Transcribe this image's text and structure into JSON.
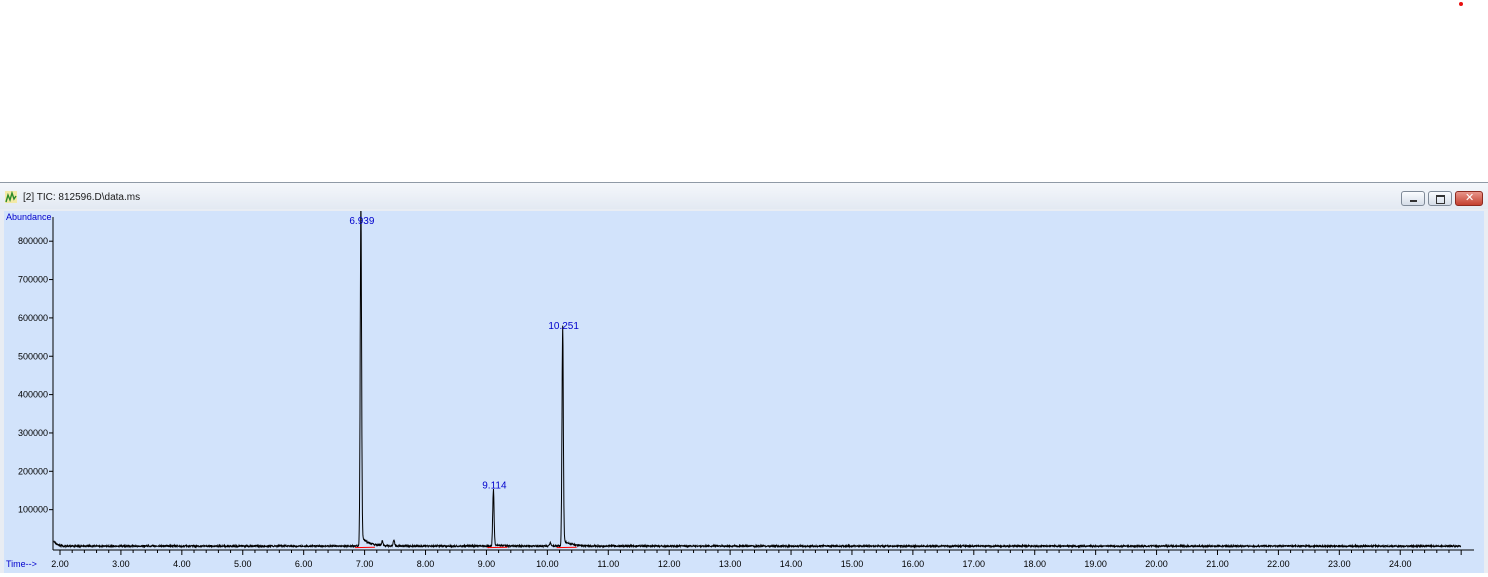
{
  "window": {
    "title": "[2] TIC: 812596.D\\data.ms",
    "controls": [
      "minimize",
      "maximize",
      "close"
    ],
    "app_icon": "chromatogram-app-icon"
  },
  "colors": {
    "plot_background": "#d2e3fb",
    "trace": "#000000",
    "labels": "#0000cc",
    "baseline": "#ff0000"
  },
  "chart_data": {
    "type": "line",
    "ylabel": "Abundance",
    "xlabel": "Time-->",
    "xlim": [
      1.9,
      25.1
    ],
    "ylim": [
      0,
      880000
    ],
    "x_ticks": [
      "2.00",
      "3.00",
      "4.00",
      "5.00",
      "6.00",
      "7.00",
      "8.00",
      "9.00",
      "10.00",
      "11.00",
      "12.00",
      "13.00",
      "14.00",
      "15.00",
      "16.00",
      "17.00",
      "18.00",
      "19.00",
      "20.00",
      "21.00",
      "22.00",
      "23.00",
      "24.00"
    ],
    "y_ticks": [
      "100000",
      "200000",
      "300000",
      "400000",
      "500000",
      "600000",
      "700000",
      "800000"
    ],
    "peaks": [
      {
        "label": "6.939",
        "rt": 6.939,
        "height": 880000
      },
      {
        "label": "9.114",
        "rt": 9.114,
        "height": 145000
      },
      {
        "label": "10.251",
        "rt": 10.251,
        "height": 560000
      }
    ],
    "minor_peaks": [
      {
        "rt": 7.29,
        "height": 12000
      },
      {
        "rt": 7.48,
        "height": 16000
      },
      {
        "rt": 10.05,
        "height": 9000
      }
    ],
    "baseline_level": 5000
  }
}
